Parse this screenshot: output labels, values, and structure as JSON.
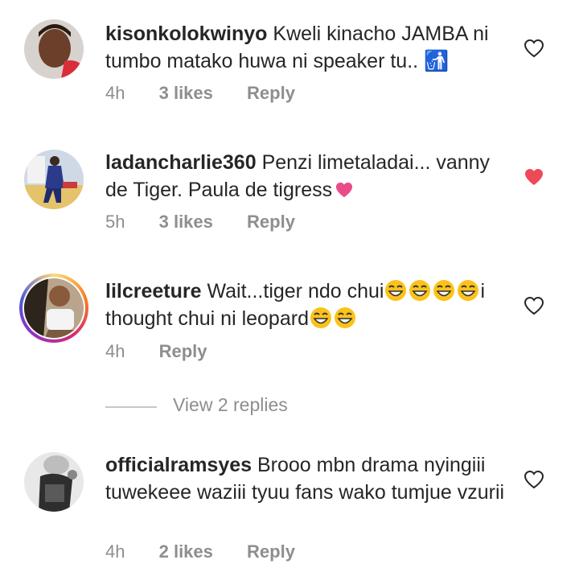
{
  "comments": [
    {
      "username": "kisonkolokwinyo",
      "text": "Kweli kinacho JAMBA ni tumbo matako huwa ni speaker tu.. 🚮",
      "time": "4h",
      "likes": "3 likes",
      "reply": "Reply",
      "liked": false
    },
    {
      "username": "ladancharlie360",
      "text": "Penzi limetaladai... vanny de Tiger. Paula de tigress",
      "time": "5h",
      "likes": "3 likes",
      "reply": "Reply",
      "liked": true
    },
    {
      "username": "lilcreeture",
      "text_a": "Wait...tiger ndo chui",
      "text_b": "i thought chui ni leopard",
      "time": "4h",
      "reply": "Reply",
      "liked": false
    },
    {
      "username": "officialramsyes",
      "text": "Brooo mbn drama nyingiii tuwekeee waziii tyuu fans wako tumjue vzurii",
      "time": "4h",
      "likes": "2 likes",
      "reply": "Reply",
      "liked": false
    }
  ],
  "view_replies": "View 2 replies",
  "colors": {
    "text": "#262626",
    "muted": "#8e8e8e",
    "liked_heart": "#ed4956",
    "pink_heart": "#ea4c89"
  }
}
